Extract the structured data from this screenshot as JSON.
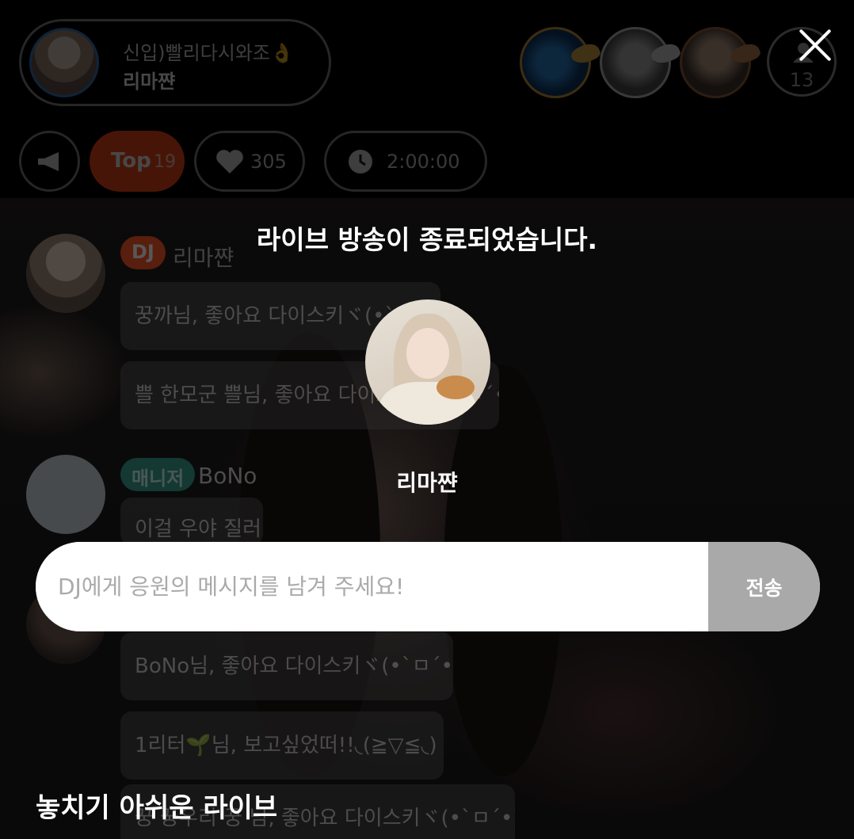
{
  "header": {
    "host_subtitle": "신입)빨리다시와조👌",
    "host_name": "리마쨘",
    "viewer_count": "13"
  },
  "chips": {
    "top_label": "Top",
    "top_rank": "19",
    "likes": "305",
    "timer": "2:00:00"
  },
  "chat": {
    "dj_badge": "DJ",
    "dj_name": "리마쨘",
    "manager_badge": "매니저",
    "manager_name": "BoNo",
    "messages": [
      "꿍까님, 좋아요 다이스키ヾ(•`ㅁ",
      "쁠 한모군 쁠님, 좋아요 다이스키ヾ(•`ㅁ´•)و",
      "이걸 우야 질러",
      "BoNo님, 좋아요 다이스키ヾ(•`ㅁ´•)و",
      "1리터🌱님, 보고싶었떠!!◟(≧▽≦◟)",
      "꿍 꿍우리 꿍 님, 좋아요 다이스키ヾ(•`ㅁ´•)و"
    ]
  },
  "modal": {
    "title": "라이브 방송이 종료되었습니다.",
    "dj_name": "리마쨘",
    "message_placeholder": "DJ에게 응원의 메시지를 남겨 주세요!",
    "send_label": "전송"
  },
  "section": {
    "missed_live_title": "놓치기 아쉬운 라이브"
  },
  "colors": {
    "accent": "#ff4e1b",
    "manager": "#2b9f8a",
    "send_button": "#a9a9a9"
  }
}
